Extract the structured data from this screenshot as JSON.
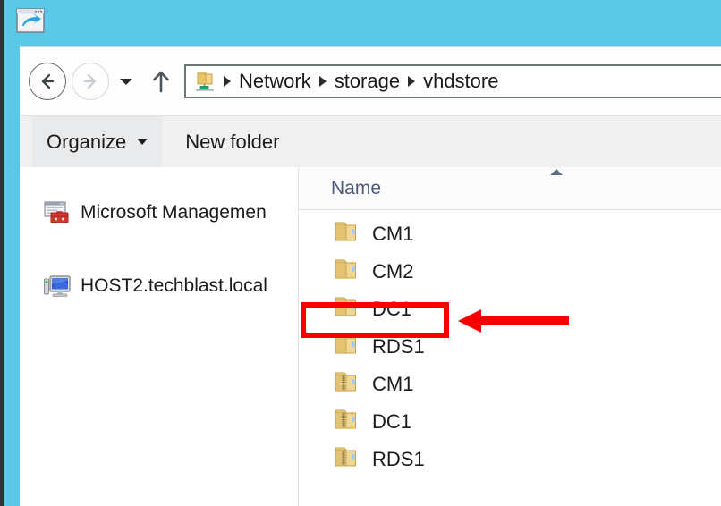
{
  "desktop": {
    "background_color": "#5bc8e8",
    "frame_edge_color": "#2e3436"
  },
  "window": {
    "title_icon": "shortcut-window-icon",
    "background_color": "#ffffff"
  },
  "navigation": {
    "back_label": "Back",
    "forward_label": "Forward",
    "recent_locations_label": "Recent locations",
    "up_label": "Up one level",
    "back_enabled": true,
    "forward_enabled": false
  },
  "address_bar": {
    "location_icon": "network-folder-icon",
    "breadcrumbs": [
      {
        "label": "Network"
      },
      {
        "label": "storage"
      },
      {
        "label": "vhdstore"
      }
    ],
    "full_path": "Network ▸ storage ▸ vhdstore"
  },
  "toolbar": {
    "organize_label": "Organize",
    "organize_has_dropdown": true,
    "new_folder_label": "New folder"
  },
  "sidebar": {
    "items": [
      {
        "label": "Microsoft Managemen",
        "icon": "mmc-console-icon",
        "truncated": true
      },
      {
        "label": "HOST2.techblast.local",
        "icon": "computer-icon",
        "truncated": false
      }
    ]
  },
  "list_pane": {
    "columns": [
      {
        "label": "Name",
        "sort": "ascending"
      }
    ],
    "items": [
      {
        "name": "CM1",
        "icon": "folder-icon"
      },
      {
        "name": "CM2",
        "icon": "folder-icon"
      },
      {
        "name": "DC1",
        "icon": "folder-icon"
      },
      {
        "name": "RDS1",
        "icon": "folder-icon"
      },
      {
        "name": "CM1",
        "icon": "compressed-folder-icon"
      },
      {
        "name": "DC1",
        "icon": "compressed-folder-icon"
      },
      {
        "name": "RDS1",
        "icon": "compressed-folder-icon"
      }
    ]
  },
  "annotations": {
    "color": "#f90000",
    "highlight_target": "DC1",
    "arrow_direction": "left",
    "shapes": [
      "rectangle-outline",
      "left-arrow"
    ]
  }
}
